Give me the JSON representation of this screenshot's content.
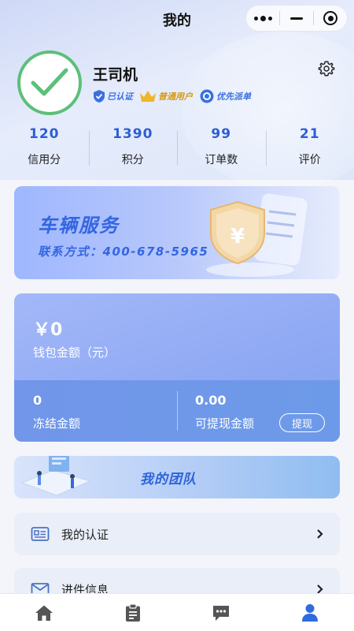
{
  "nav": {
    "title": "我的"
  },
  "profile": {
    "name": "王司机",
    "badges": [
      {
        "label": "已认证",
        "icon": "shield-check-icon"
      },
      {
        "label": "普通用户",
        "icon": "crown-icon"
      },
      {
        "label": "优先派单",
        "icon": "dispatch-icon"
      }
    ]
  },
  "stats": [
    {
      "value": "120",
      "label": "信用分"
    },
    {
      "value": "1390",
      "label": "积分"
    },
    {
      "value": "99",
      "label": "订单数"
    },
    {
      "value": "21",
      "label": "评价"
    }
  ],
  "service": {
    "title": "车辆服务",
    "contact": "联系方式：400-678-5965"
  },
  "wallet": {
    "amount": "￥0",
    "label": "钱包金额（元）",
    "frozen_value": "0",
    "frozen_label": "冻结金额",
    "withdrawable_value": "0.00",
    "withdrawable_label": "可提现金额",
    "withdraw_button": "提现"
  },
  "team": {
    "title": "我的团队"
  },
  "menu": [
    {
      "label": "我的认证",
      "icon": "id-card-icon"
    },
    {
      "label": "进件信息",
      "icon": "mail-icon"
    }
  ],
  "tabs": [
    {
      "name": "home",
      "icon": "home-icon",
      "active": false
    },
    {
      "name": "orders",
      "icon": "clipboard-icon",
      "active": false
    },
    {
      "name": "messages",
      "icon": "chat-icon",
      "active": false
    },
    {
      "name": "profile",
      "icon": "user-icon",
      "active": true
    }
  ],
  "colors": {
    "accent": "#2d5ed6",
    "inactive_tab": "#555555",
    "active_tab": "#2f6ae0",
    "avatar_green": "#5cbf7a"
  }
}
